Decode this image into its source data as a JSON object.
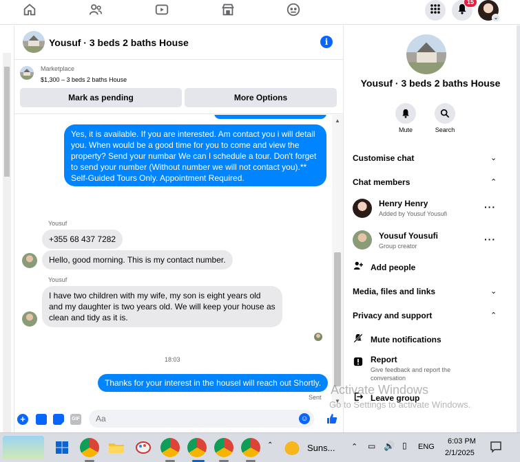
{
  "nav": {
    "notification_count": "15"
  },
  "chat": {
    "title": "Yousuf · 3 beds 2 baths House",
    "marketplace": {
      "label": "Marketplace",
      "desc": "$1,300 – 3 beds 2 baths House",
      "pending_btn": "Mark as pending",
      "more_btn": "More Options"
    },
    "messages": {
      "out1": "Yes, it is available. If you are interested.  Am contact you i will detail you.  When would be a good time for you to come and view the property? Send your numbar We can I schedule a tour.  Don't forget to send your number (Without number we will not contact you).** Self-Guided Tours Only. Appointment Required.",
      "sender1": "Yousuf",
      "in1": "+355 68 437 7282",
      "in2": "Hello, good morning. This is my contact number.",
      "sender2": "Yousuf",
      "in3": "I have two children with my wife, my son is eight years old and my daughter is two years old. We will keep your house as clean and tidy as it is.",
      "time": "18:03",
      "out2": "Thanks for your interest in the housel will reach out Shortly.",
      "status": "Sent"
    },
    "composer_placeholder": "Aa"
  },
  "panel": {
    "title": "Yousuf · 3 beds 2 baths House",
    "mute": "Mute",
    "search": "Search",
    "customise": "Customise chat",
    "members_heading": "Chat members",
    "members": [
      {
        "name": "Henry Henry",
        "sub": "Added by Yousuf Yousufi"
      },
      {
        "name": "Yousuf Yousufi",
        "sub": "Group creator"
      }
    ],
    "add_people": "Add people",
    "media": "Media, files and links",
    "privacy": "Privacy and support",
    "mute_notifications": "Mute notifications",
    "report": "Report",
    "report_sub": "Give feedback and report the conversation",
    "leave": "Leave group"
  },
  "watermark": {
    "line1": "Activate Windows",
    "line2": "Go to Settings to activate Windows."
  },
  "taskbar": {
    "weather": "Suns...",
    "lang": "ENG",
    "time": "6:03 PM",
    "date": "2/1/2025"
  },
  "colors": {
    "accent": "#0084ff",
    "brand_blue": "#0866ff",
    "badge_red": "#e41e3f"
  }
}
